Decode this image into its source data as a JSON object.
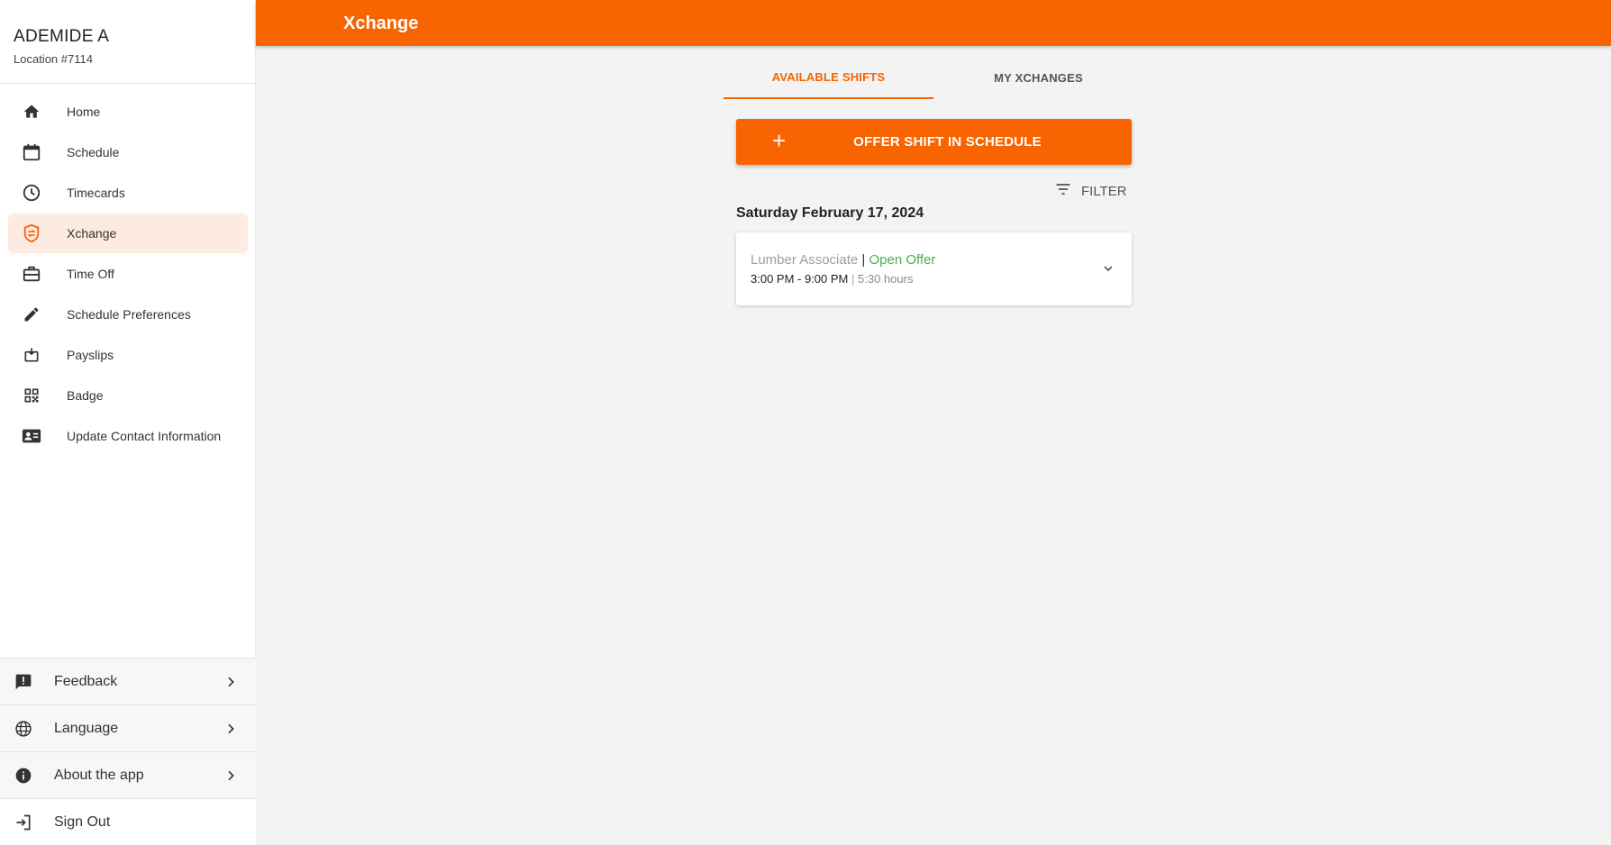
{
  "user": {
    "name": "ADEMIDE A",
    "location": "Location #7114"
  },
  "nav": [
    {
      "label": "Home",
      "icon": "home-icon"
    },
    {
      "label": "Schedule",
      "icon": "calendar-icon"
    },
    {
      "label": "Timecards",
      "icon": "clock-icon"
    },
    {
      "label": "Xchange",
      "icon": "xchange-icon",
      "active": true
    },
    {
      "label": "Time Off",
      "icon": "briefcase-icon"
    },
    {
      "label": "Schedule Preferences",
      "icon": "pencil-icon"
    },
    {
      "label": "Payslips",
      "icon": "payslip-icon"
    },
    {
      "label": "Badge",
      "icon": "qr-code-icon"
    },
    {
      "label": "Update Contact Information",
      "icon": "contact-card-icon"
    }
  ],
  "bottom": [
    {
      "label": "Feedback",
      "icon": "feedback-icon"
    },
    {
      "label": "Language",
      "icon": "globe-icon"
    },
    {
      "label": "About the app",
      "icon": "info-icon"
    },
    {
      "label": "Sign Out",
      "icon": "sign-out-icon"
    }
  ],
  "header": {
    "title": "Xchange"
  },
  "tabs": [
    {
      "label": "AVAILABLE SHIFTS",
      "active": true
    },
    {
      "label": "MY XCHANGES",
      "active": false
    }
  ],
  "offer_button": {
    "plus": "+",
    "label": "OFFER SHIFT IN SCHEDULE"
  },
  "filter": {
    "label": "FILTER"
  },
  "date_heading": "Saturday February 17, 2024",
  "shift": {
    "role": "Lumber Associate",
    "separator": "|",
    "status": "Open Offer",
    "time": "3:00 PM - 9:00 PM",
    "separator2": "|",
    "hours": "5:30 hours"
  },
  "colors": {
    "accent": "#f76400",
    "active_bg": "#fdeae0",
    "status_green": "#4caf50"
  }
}
